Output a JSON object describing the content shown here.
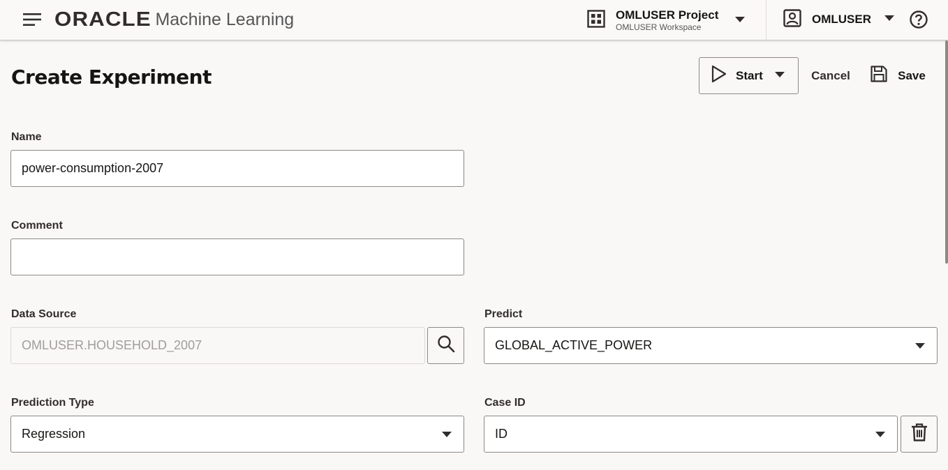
{
  "header": {
    "brand": "ORACLE",
    "product": "Machine Learning",
    "project": {
      "title": "OMLUSER Project",
      "subtitle": "OMLUSER Workspace"
    },
    "user": "OMLUSER"
  },
  "page": {
    "title": "Create Experiment",
    "actions": {
      "start": "Start",
      "cancel": "Cancel",
      "save": "Save"
    }
  },
  "form": {
    "name": {
      "label": "Name",
      "value": "power-consumption-2007"
    },
    "comment": {
      "label": "Comment",
      "value": ""
    },
    "data_source": {
      "label": "Data Source",
      "value": "OMLUSER.HOUSEHOLD_2007"
    },
    "predict": {
      "label": "Predict",
      "value": "GLOBAL_ACTIVE_POWER"
    },
    "prediction_type": {
      "label": "Prediction Type",
      "value": "Regression"
    },
    "case_id": {
      "label": "Case ID",
      "value": "ID"
    }
  },
  "icons": {
    "menu": "hamburger-icon",
    "project": "grid-icon",
    "user": "user-icon",
    "help": "help-icon",
    "start": "play-icon",
    "save": "floppy-disk-icon",
    "search": "search-icon",
    "delete": "trash-icon",
    "dropdown": "caret-down-icon"
  }
}
